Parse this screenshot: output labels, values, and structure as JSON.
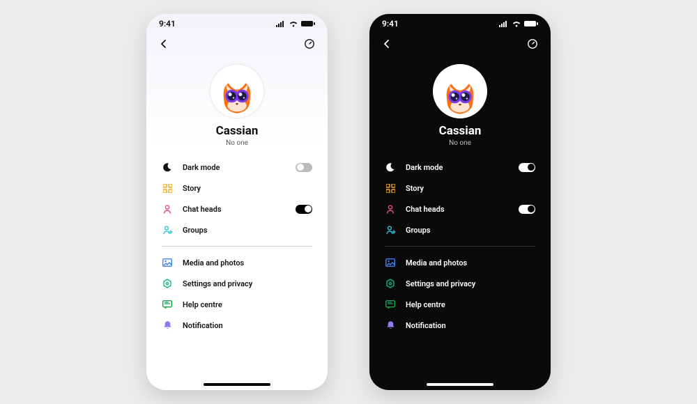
{
  "status_time": "9:41",
  "profile": {
    "name": "Cassian",
    "status": "No one"
  },
  "menu": {
    "dark_mode": "Dark mode",
    "story": "Story",
    "chat_heads": "Chat heads",
    "groups": "Groups",
    "media": "Media and photos",
    "settings": "Settings and privacy",
    "help": "Help centre",
    "notification": "Notification"
  },
  "colors": {
    "moon": "#111111",
    "story": "#f5a623",
    "chat_heads": "#e6497e",
    "groups": "#29c5d8",
    "media": "#3b82f6",
    "settings": "#10b981",
    "help": "#16a34a",
    "notification": "#8b7cf0"
  },
  "toggles": {
    "light": {
      "dark_mode": false,
      "chat_heads": true
    },
    "dark": {
      "dark_mode": true,
      "chat_heads": true
    }
  }
}
